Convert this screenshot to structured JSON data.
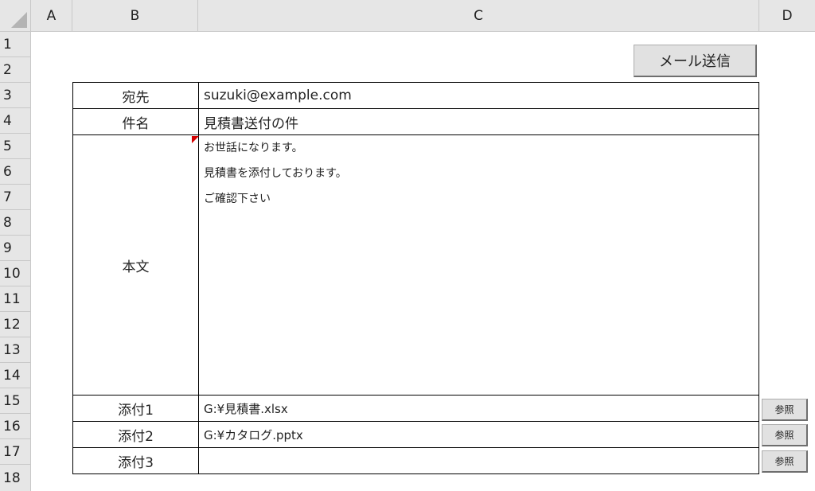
{
  "columns": [
    "A",
    "B",
    "C",
    "D"
  ],
  "rows": [
    "1",
    "2",
    "3",
    "4",
    "5",
    "6",
    "7",
    "8",
    "9",
    "10",
    "11",
    "12",
    "13",
    "14",
    "15",
    "16",
    "17",
    "18"
  ],
  "send_button_label": "メール送信",
  "form": {
    "to_label": "宛先",
    "to_value": "suzuki@example.com",
    "subject_label": "件名",
    "subject_value": "見積書送付の件",
    "body_label": "本文",
    "body_lines": [
      "お世話になります。",
      "見積書を添付しております。",
      "ご確認下さい"
    ],
    "attachments": [
      {
        "label": "添付1",
        "value": "G:¥見積書.xlsx",
        "button": "参照"
      },
      {
        "label": "添付2",
        "value": "G:¥カタログ.pptx",
        "button": "参照"
      },
      {
        "label": "添付3",
        "value": "",
        "button": "参照"
      }
    ]
  }
}
